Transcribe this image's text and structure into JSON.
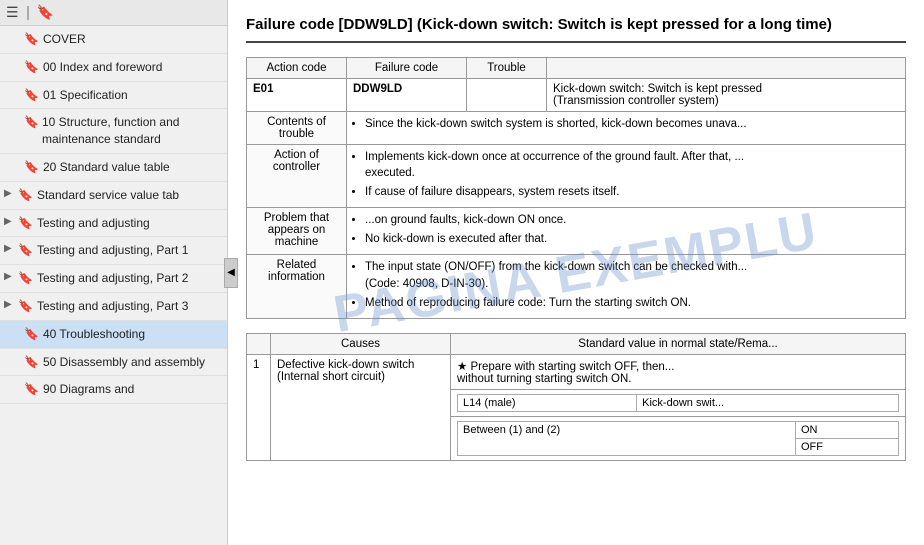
{
  "sidebar": {
    "toolbar": {
      "icon1": "☰",
      "icon2": "🔖"
    },
    "items": [
      {
        "id": "cover",
        "label": "COVER",
        "hasArrow": false,
        "active": false
      },
      {
        "id": "00-index",
        "label": "00 Index and foreword",
        "hasArrow": false,
        "active": false
      },
      {
        "id": "01-spec",
        "label": "01 Specification",
        "hasArrow": false,
        "active": false
      },
      {
        "id": "10-structure",
        "label": "10 Structure, function and maintenance standard",
        "hasArrow": false,
        "active": false
      },
      {
        "id": "20-standard",
        "label": "20 Standard value table",
        "hasArrow": false,
        "active": false
      },
      {
        "id": "std-service",
        "label": "Standard service value tab",
        "hasArrow": true,
        "active": false
      },
      {
        "id": "testing-adj",
        "label": "Testing and adjusting",
        "hasArrow": true,
        "active": false
      },
      {
        "id": "testing-adj-1",
        "label": "Testing and adjusting, Part 1",
        "hasArrow": true,
        "active": false
      },
      {
        "id": "testing-adj-2",
        "label": "Testing and adjusting, Part 2",
        "hasArrow": true,
        "active": false
      },
      {
        "id": "testing-adj-3",
        "label": "Testing and adjusting, Part 3",
        "hasArrow": true,
        "active": false
      },
      {
        "id": "40-trouble",
        "label": "40 Troubleshooting",
        "hasArrow": false,
        "active": true
      },
      {
        "id": "50-disassembly",
        "label": "50 Disassembly and assembly",
        "hasArrow": false,
        "active": false
      },
      {
        "id": "90-diagrams",
        "label": "90 Diagrams and",
        "hasArrow": false,
        "active": false
      }
    ]
  },
  "main": {
    "title": "Failure code [DDW9LD] (Kick-down switch: Switch is kept pressed for a long time)",
    "title_short": "Failure code [DDW9LD] (Kick-down switch: Switch is ke...\nlong time)",
    "table1": {
      "headers": [
        "Action code",
        "Failure code",
        "Trouble"
      ],
      "action_code": "E01",
      "failure_code": "DDW9LD",
      "trouble_text": "Kick-down switch: Switch is kept pressed\n(Transmission controller system)",
      "rows": [
        {
          "header": "Contents of trouble",
          "content": "Since the kick-down switch system is shorted, kick-down becomes unava..."
        },
        {
          "header": "Action of controller",
          "bullets": [
            "Implements kick-down once at occurrence of the ground fault. After that, ...\nexecuted.",
            "If cause of failure disappears, system resets itself."
          ]
        },
        {
          "header": "Problem that appears on machine",
          "bullets": [
            "...on ground faults, kick-down ON once.",
            "No kick-down is executed after that."
          ]
        },
        {
          "header": "Related information",
          "bullets": [
            "The input state (ON/OFF) from the kick-down switch can be checked with...\n(Code: 40908, D-IN-30).",
            "Method of reproducing failure code: Turn the starting switch ON."
          ]
        }
      ]
    },
    "table2": {
      "col_headers": [
        "",
        "Causes",
        "Standard value in normal state/Rema..."
      ],
      "rows": [
        {
          "num": "1",
          "cause": "Defective kick-down switch\n(Internal short circuit)",
          "sub_rows": [
            {
              "label": "★ Prepare with starting switch OFF, then...\nwithout turning starting switch ON."
            },
            {
              "connector": "L14 (male)",
              "measurement": "Kick-down swit..."
            },
            {
              "connector": "Between (1) and (2)",
              "values": [
                "ON",
                "OFF"
              ]
            }
          ]
        }
      ]
    }
  },
  "watermark": "PAGINA EXEMPLU"
}
